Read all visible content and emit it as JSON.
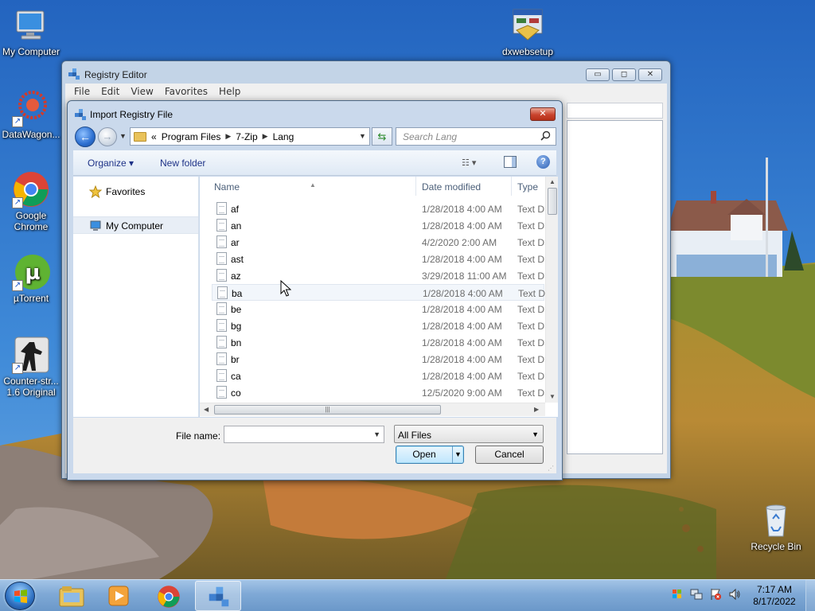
{
  "desktop": {
    "icons": [
      {
        "label": "My Computer"
      },
      {
        "label": "DataWagon..."
      },
      {
        "label": "Google Chrome"
      },
      {
        "label": "µTorrent"
      },
      {
        "label": "Counter-str... 1.6 Original"
      },
      {
        "label": "dxwebsetup"
      },
      {
        "label": "Recycle Bin"
      }
    ]
  },
  "regedit": {
    "title": "Registry Editor",
    "menu": [
      "File",
      "Edit",
      "View",
      "Favorites",
      "Help"
    ],
    "buttons": {
      "minimize": "▭",
      "maximize": "◻",
      "close": "✕"
    }
  },
  "dialog": {
    "title": "Import Registry File",
    "close_label": "✕",
    "breadcrumb": {
      "prefix": "«",
      "items": [
        "Program Files",
        "7-Zip",
        "Lang"
      ]
    },
    "search_placeholder": "Search Lang",
    "toolbar": {
      "organize": "Organize ▾",
      "new_folder": "New folder",
      "help": "?"
    },
    "nav": {
      "favorites": "Favorites",
      "my_computer": "My Computer"
    },
    "columns": {
      "name": "Name",
      "date": "Date modified",
      "type": "Type"
    },
    "files": [
      {
        "name": "af",
        "date": "1/28/2018 4:00 AM",
        "type": "Text D"
      },
      {
        "name": "an",
        "date": "1/28/2018 4:00 AM",
        "type": "Text D"
      },
      {
        "name": "ar",
        "date": "4/2/2020 2:00 AM",
        "type": "Text D"
      },
      {
        "name": "ast",
        "date": "1/28/2018 4:00 AM",
        "type": "Text D"
      },
      {
        "name": "az",
        "date": "3/29/2018 11:00 AM",
        "type": "Text D"
      },
      {
        "name": "ba",
        "date": "1/28/2018 4:00 AM",
        "type": "Text D"
      },
      {
        "name": "be",
        "date": "1/28/2018 4:00 AM",
        "type": "Text D"
      },
      {
        "name": "bg",
        "date": "1/28/2018 4:00 AM",
        "type": "Text D"
      },
      {
        "name": "bn",
        "date": "1/28/2018 4:00 AM",
        "type": "Text D"
      },
      {
        "name": "br",
        "date": "1/28/2018 4:00 AM",
        "type": "Text D"
      },
      {
        "name": "ca",
        "date": "1/28/2018 4:00 AM",
        "type": "Text D"
      },
      {
        "name": "co",
        "date": "12/5/2020 9:00 AM",
        "type": "Text D"
      }
    ],
    "hovered_file": "ba",
    "file_name_label": "File name:",
    "file_name_value": "",
    "file_type": "All Files",
    "open_label": "Open",
    "cancel_label": "Cancel"
  },
  "taskbar": {
    "clock_time": "7:17 AM",
    "clock_date": "8/17/2022",
    "apps": [
      "windows-explorer",
      "media-player",
      "google-chrome",
      "registry-editor"
    ],
    "active_app": "registry-editor"
  },
  "colors": {
    "sky": "#2f74c8",
    "dialog_frame": "#cad9ec",
    "taskbar": "#7fa9d6",
    "selection": "#e8eef6"
  }
}
